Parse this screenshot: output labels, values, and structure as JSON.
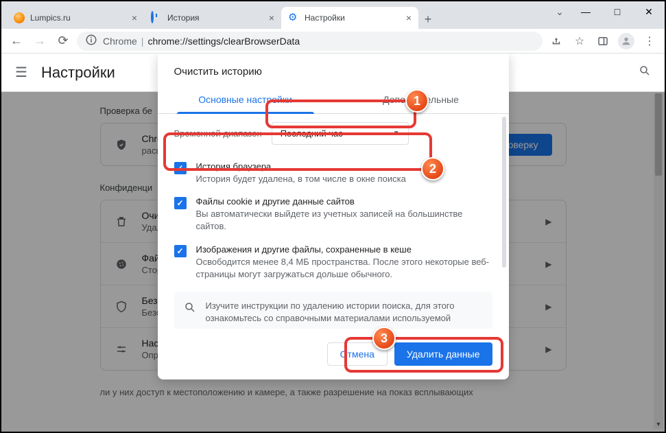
{
  "window": {
    "minimize": "—",
    "maximize": "□",
    "close": "✕",
    "dropdown": "⌄"
  },
  "tabs": [
    {
      "title": "Lumpics.ru",
      "active": false
    },
    {
      "title": "История",
      "active": false
    },
    {
      "title": "Настройки",
      "active": true
    }
  ],
  "toolbar": {
    "chrome_label": "Chrome",
    "url": "chrome://settings/clearBrowserData"
  },
  "settings": {
    "page_title": "Настройки",
    "section_check": "Проверка бе",
    "safety_row_title": "Chro",
    "safety_row_sub": "расш",
    "safety_button": "роверку",
    "section_privacy": "Конфиденци",
    "rows": [
      {
        "title": "Очис",
        "sub": "Удал"
      },
      {
        "title": "Файл",
        "sub": "Стор"
      },
      {
        "title": "Безо",
        "sub": "Безо"
      },
      {
        "title": "Настр",
        "sub": "Опре"
      }
    ],
    "footer_text": "ли у них доступ к местоположению и камере, а также разрешение на показ всплывающих"
  },
  "dialog": {
    "title": "Очистить историю",
    "tab_basic": "Основные настройки",
    "tab_adv": "Дополнительные",
    "time_label": "Временной диапазон",
    "time_value": "Последний час",
    "items": [
      {
        "title": "История браузера",
        "sub": "История будет удалена, в том числе в окне поиска"
      },
      {
        "title": "Файлы cookie и другие данные сайтов",
        "sub": "Вы автоматически выйдете из учетных записей на большинстве сайтов."
      },
      {
        "title": "Изображения и другие файлы, сохраненные в кеше",
        "sub": "Освободится менее 8,4 МБ пространства. После этого некоторые веб-страницы могут загружаться дольше обычного."
      }
    ],
    "info_text": "Изучите инструкции по удалению истории поиска, для этого ознакомьтесь со справочными материалами используемой",
    "cancel": "Отмена",
    "delete": "Удалить данные"
  },
  "badges": {
    "b1": "1",
    "b2": "2",
    "b3": "3"
  }
}
